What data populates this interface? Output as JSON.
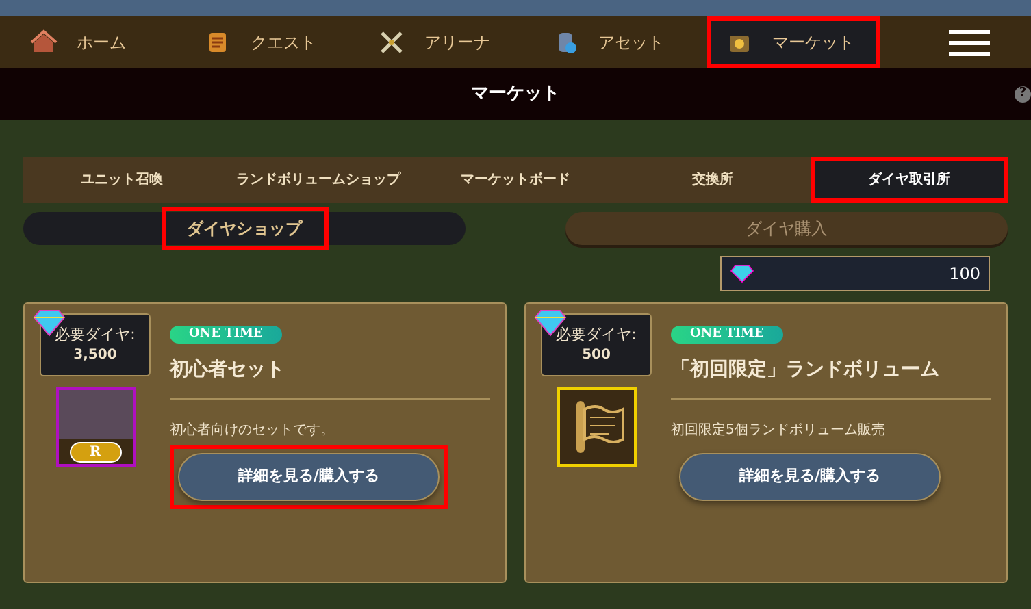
{
  "nav": [
    {
      "label": "ホーム",
      "selected": false,
      "highlighted": false
    },
    {
      "label": "クエスト",
      "selected": false,
      "highlighted": false
    },
    {
      "label": "アリーナ",
      "selected": false,
      "highlighted": false
    },
    {
      "label": "アセット",
      "selected": false,
      "highlighted": false
    },
    {
      "label": "マーケット",
      "selected": true,
      "highlighted": true
    }
  ],
  "title": "マーケット",
  "help": "?",
  "tabs": [
    {
      "label": "ユニット召喚",
      "selected": false,
      "highlighted": false
    },
    {
      "label": "ランドボリュームショップ",
      "selected": false,
      "highlighted": false
    },
    {
      "label": "マーケットボード",
      "selected": false,
      "highlighted": false
    },
    {
      "label": "交換所",
      "selected": false,
      "highlighted": false
    },
    {
      "label": "ダイヤ取引所",
      "selected": true,
      "highlighted": true
    }
  ],
  "subtabs": [
    {
      "label": "ダイヤショップ",
      "selected": true,
      "highlighted": true
    },
    {
      "label": "ダイヤ購入",
      "selected": false,
      "highlighted": false
    }
  ],
  "balance": "100",
  "cards": [
    {
      "price_label": "必要ダイヤ:",
      "price": "3,500",
      "badge": "ONE TIME",
      "name": "初心者セット",
      "description": "初心者向けのセットです。",
      "kind": "unit",
      "rarity": "R",
      "button": "詳細を見る/購入する",
      "button_highlighted": true
    },
    {
      "price_label": "必要ダイヤ:",
      "price": "500",
      "badge": "ONE TIME",
      "name": "「初回限定」ランドボリューム",
      "description": "初回限定5個ランドボリューム販売",
      "kind": "scroll",
      "button": "詳細を見る/購入する",
      "button_highlighted": false
    }
  ]
}
